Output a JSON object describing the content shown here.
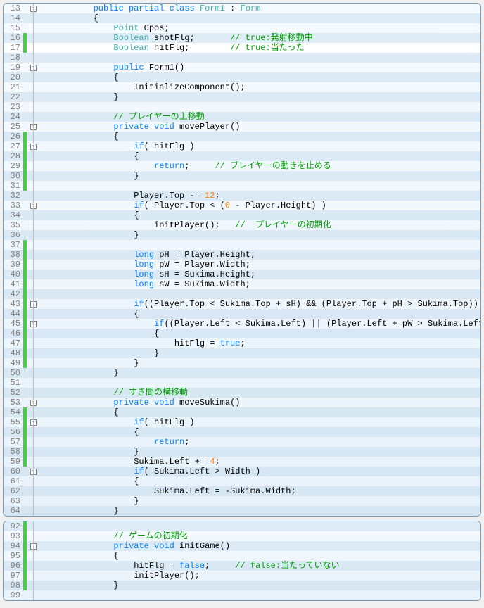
{
  "block1": {
    "lines": [
      {
        "n": 13,
        "alt": false,
        "mark": false,
        "fold": "minus",
        "guides": 0,
        "html": "<span class='kw'>public</span> <span class='kw'>partial</span> <span class='kw'>class</span> <span class='cls'>Form1</span> : <span class='cls'>Form</span>",
        "indent": 2
      },
      {
        "n": 14,
        "alt": true,
        "mark": false,
        "fold": "line",
        "guides": 0,
        "html": "{",
        "indent": 2
      },
      {
        "n": 15,
        "alt": false,
        "mark": false,
        "fold": "line",
        "guides": 1,
        "html": "<span class='cls'>Point</span> Cpos;",
        "indent": 3
      },
      {
        "n": 16,
        "alt": true,
        "mark": true,
        "fold": "line",
        "guides": 1,
        "html": "<span class='cls'>Boolean</span> shotFlg;       <span class='com'>// true:発射移動中</span>",
        "indent": 3
      },
      {
        "n": 17,
        "alt": false,
        "mark": true,
        "fold": "line",
        "guides": 1,
        "html": "<span class='cls'>Boolean</span> hitFlg;        <span class='com'>// true:当たった</span>",
        "indent": 3,
        "highlight": true
      },
      {
        "n": 18,
        "alt": true,
        "mark": false,
        "fold": "line",
        "guides": 1,
        "html": "",
        "indent": 3
      },
      {
        "n": 19,
        "alt": false,
        "mark": false,
        "fold": "minus",
        "guides": 1,
        "html": "<span class='kw'>public</span> Form1()",
        "indent": 3
      },
      {
        "n": 20,
        "alt": true,
        "mark": false,
        "fold": "line",
        "guides": 1,
        "html": "{",
        "indent": 3
      },
      {
        "n": 21,
        "alt": false,
        "mark": false,
        "fold": "line",
        "guides": 2,
        "html": "InitializeComponent();",
        "indent": 4
      },
      {
        "n": 22,
        "alt": true,
        "mark": false,
        "fold": "line",
        "guides": 1,
        "html": "}",
        "indent": 3
      },
      {
        "n": 23,
        "alt": false,
        "mark": false,
        "fold": "line",
        "guides": 1,
        "html": "",
        "indent": 3
      },
      {
        "n": 24,
        "alt": true,
        "mark": false,
        "fold": "line",
        "guides": 1,
        "html": "<span class='com'>// プレイヤーの上移動</span>",
        "indent": 3
      },
      {
        "n": 25,
        "alt": false,
        "mark": false,
        "fold": "minus",
        "guides": 1,
        "html": "<span class='kw'>private</span> <span class='kw'>void</span> movePlayer()",
        "indent": 3
      },
      {
        "n": 26,
        "alt": true,
        "mark": true,
        "fold": "line",
        "guides": 1,
        "html": "{",
        "indent": 3
      },
      {
        "n": 27,
        "alt": false,
        "mark": true,
        "fold": "minus",
        "guides": 2,
        "html": "<span class='kw'>if</span>( hitFlg )",
        "indent": 4
      },
      {
        "n": 28,
        "alt": true,
        "mark": true,
        "fold": "line",
        "guides": 2,
        "html": "{",
        "indent": 4
      },
      {
        "n": 29,
        "alt": false,
        "mark": true,
        "fold": "line",
        "guides": 3,
        "html": "<span class='kw'>return</span>;     <span class='com'>// プレイヤーの動きを止める</span>",
        "indent": 5
      },
      {
        "n": 30,
        "alt": true,
        "mark": true,
        "fold": "line",
        "guides": 2,
        "html": "}",
        "indent": 4
      },
      {
        "n": 31,
        "alt": false,
        "mark": true,
        "fold": "line",
        "guides": 2,
        "html": "",
        "indent": 4
      },
      {
        "n": 32,
        "alt": true,
        "mark": false,
        "fold": "line",
        "guides": 2,
        "html": "Player.Top -= <span class='num'>12</span>;",
        "indent": 4
      },
      {
        "n": 33,
        "alt": false,
        "mark": false,
        "fold": "minus",
        "guides": 2,
        "html": "<span class='kw'>if</span>( Player.Top < (<span class='num'>0</span> - Player.Height) )",
        "indent": 4
      },
      {
        "n": 34,
        "alt": true,
        "mark": false,
        "fold": "line",
        "guides": 2,
        "html": "{",
        "indent": 4
      },
      {
        "n": 35,
        "alt": false,
        "mark": false,
        "fold": "line",
        "guides": 3,
        "html": "initPlayer();   <span class='com'>//  プレイヤーの初期化</span>",
        "indent": 5
      },
      {
        "n": 36,
        "alt": true,
        "mark": false,
        "fold": "line",
        "guides": 2,
        "html": "}",
        "indent": 4
      },
      {
        "n": 37,
        "alt": false,
        "mark": true,
        "fold": "line",
        "guides": 2,
        "html": "",
        "indent": 4
      },
      {
        "n": 38,
        "alt": true,
        "mark": true,
        "fold": "line",
        "guides": 2,
        "html": "<span class='kw'>long</span> pH = Player.Height;",
        "indent": 4
      },
      {
        "n": 39,
        "alt": false,
        "mark": true,
        "fold": "line",
        "guides": 2,
        "html": "<span class='kw'>long</span> pW = Player.Width;",
        "indent": 4
      },
      {
        "n": 40,
        "alt": true,
        "mark": true,
        "fold": "line",
        "guides": 2,
        "html": "<span class='kw'>long</span> sH = Sukima.Height;",
        "indent": 4
      },
      {
        "n": 41,
        "alt": false,
        "mark": true,
        "fold": "line",
        "guides": 2,
        "html": "<span class='kw'>long</span> sW = Sukima.Width;",
        "indent": 4
      },
      {
        "n": 42,
        "alt": true,
        "mark": true,
        "fold": "line",
        "guides": 2,
        "html": "",
        "indent": 4
      },
      {
        "n": 43,
        "alt": false,
        "mark": true,
        "fold": "minus",
        "guides": 2,
        "html": "<span class='kw'>if</span>((Player.Top < Sukima.Top + sH) && (Player.Top + pH > Sukima.Top))",
        "indent": 4
      },
      {
        "n": 44,
        "alt": true,
        "mark": true,
        "fold": "line",
        "guides": 2,
        "html": "{",
        "indent": 4
      },
      {
        "n": 45,
        "alt": false,
        "mark": true,
        "fold": "minus",
        "guides": 3,
        "html": "<span class='kw'>if</span>((Player.Left < Sukima.Left) || (Player.Left + pW > Sukima.Left + sW))",
        "indent": 5
      },
      {
        "n": 46,
        "alt": true,
        "mark": true,
        "fold": "line",
        "guides": 3,
        "html": "{",
        "indent": 5
      },
      {
        "n": 47,
        "alt": false,
        "mark": true,
        "fold": "line",
        "guides": 4,
        "html": "hitFlg = <span class='lit'>true</span>;",
        "indent": 6
      },
      {
        "n": 48,
        "alt": true,
        "mark": true,
        "fold": "line",
        "guides": 3,
        "html": "}",
        "indent": 5
      },
      {
        "n": 49,
        "alt": false,
        "mark": true,
        "fold": "line",
        "guides": 2,
        "html": "}",
        "indent": 4
      },
      {
        "n": 50,
        "alt": true,
        "mark": false,
        "fold": "line",
        "guides": 1,
        "html": "}",
        "indent": 3
      },
      {
        "n": 51,
        "alt": false,
        "mark": false,
        "fold": "line",
        "guides": 1,
        "html": "",
        "indent": 3
      },
      {
        "n": 52,
        "alt": true,
        "mark": false,
        "fold": "line",
        "guides": 1,
        "html": "<span class='com'>// すき間の横移動</span>",
        "indent": 3
      },
      {
        "n": 53,
        "alt": false,
        "mark": false,
        "fold": "minus",
        "guides": 1,
        "html": "<span class='kw'>private</span> <span class='kw'>void</span> moveSukima()",
        "indent": 3
      },
      {
        "n": 54,
        "alt": true,
        "mark": true,
        "fold": "line",
        "guides": 1,
        "html": "{",
        "indent": 3
      },
      {
        "n": 55,
        "alt": false,
        "mark": true,
        "fold": "minus",
        "guides": 2,
        "html": "<span class='kw'>if</span>( hitFlg )",
        "indent": 4
      },
      {
        "n": 56,
        "alt": true,
        "mark": true,
        "fold": "line",
        "guides": 2,
        "html": "{",
        "indent": 4
      },
      {
        "n": 57,
        "alt": false,
        "mark": true,
        "fold": "line",
        "guides": 3,
        "html": "<span class='kw'>return</span>;",
        "indent": 5
      },
      {
        "n": 58,
        "alt": true,
        "mark": true,
        "fold": "line",
        "guides": 2,
        "html": "}",
        "indent": 4
      },
      {
        "n": 59,
        "alt": false,
        "mark": true,
        "fold": "line",
        "guides": 2,
        "html": "Sukima.Left += <span class='num'>4</span>;",
        "indent": 4
      },
      {
        "n": 60,
        "alt": true,
        "mark": false,
        "fold": "minus",
        "guides": 2,
        "html": "<span class='kw'>if</span>( Sukima.Left > Width )",
        "indent": 4
      },
      {
        "n": 61,
        "alt": false,
        "mark": false,
        "fold": "line",
        "guides": 2,
        "html": "{",
        "indent": 4
      },
      {
        "n": 62,
        "alt": true,
        "mark": false,
        "fold": "line",
        "guides": 3,
        "html": "Sukima.Left = -Sukima.Width;",
        "indent": 5
      },
      {
        "n": 63,
        "alt": false,
        "mark": false,
        "fold": "line",
        "guides": 2,
        "html": "}",
        "indent": 4
      },
      {
        "n": 64,
        "alt": true,
        "mark": false,
        "fold": "line",
        "guides": 1,
        "html": "}",
        "indent": 3
      }
    ]
  },
  "block2": {
    "lines": [
      {
        "n": 92,
        "alt": true,
        "mark": true,
        "fold": "line",
        "guides": 1,
        "html": "",
        "indent": 3
      },
      {
        "n": 93,
        "alt": false,
        "mark": true,
        "fold": "line",
        "guides": 1,
        "html": "<span class='com'>// ゲームの初期化</span>",
        "indent": 3
      },
      {
        "n": 94,
        "alt": true,
        "mark": true,
        "fold": "minus",
        "guides": 1,
        "html": "<span class='kw'>private</span> <span class='kw'>void</span> initGame()",
        "indent": 3
      },
      {
        "n": 95,
        "alt": false,
        "mark": true,
        "fold": "line",
        "guides": 1,
        "html": "{",
        "indent": 3
      },
      {
        "n": 96,
        "alt": true,
        "mark": true,
        "fold": "line",
        "guides": 2,
        "html": "hitFlg = <span class='lit'>false</span>;     <span class='com'>// false:当たっていない</span>",
        "indent": 4
      },
      {
        "n": 97,
        "alt": false,
        "mark": true,
        "fold": "line",
        "guides": 2,
        "html": "initPlayer();",
        "indent": 4
      },
      {
        "n": 98,
        "alt": true,
        "mark": true,
        "fold": "line",
        "guides": 1,
        "html": "}",
        "indent": 3
      },
      {
        "n": 99,
        "alt": false,
        "mark": false,
        "fold": "line",
        "guides": 1,
        "html": "",
        "indent": 3
      }
    ]
  },
  "indentUnit": "    "
}
